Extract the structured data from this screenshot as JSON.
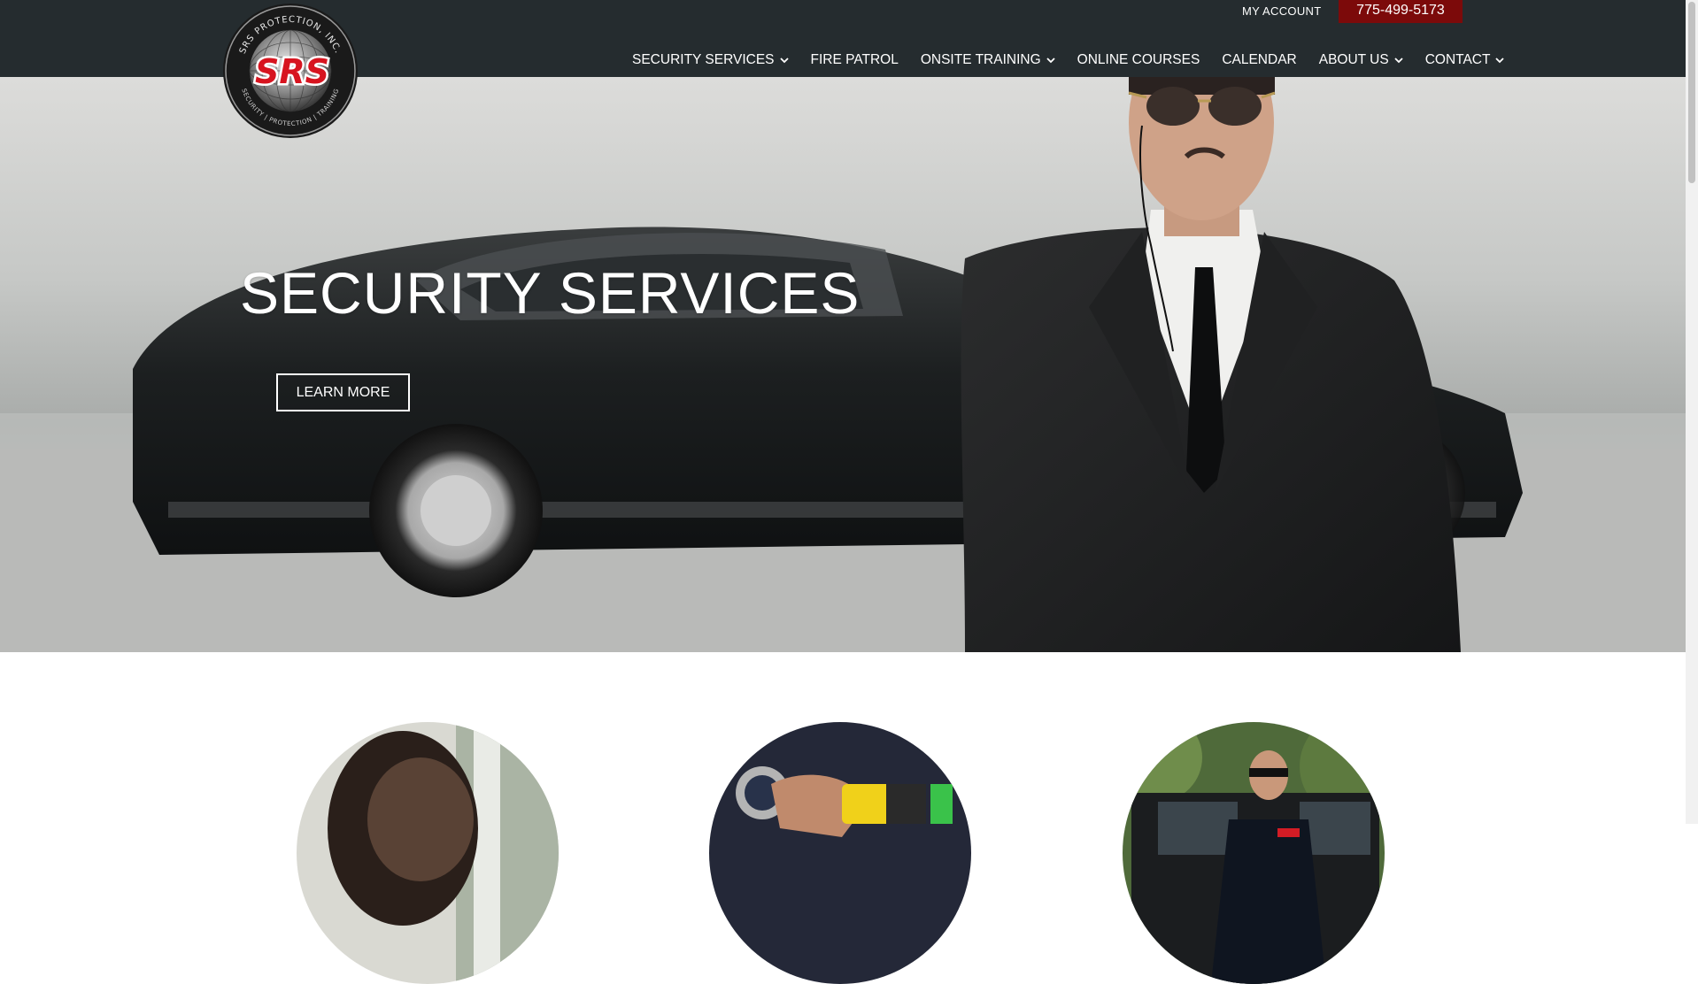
{
  "header": {
    "logo_alt": "SRS Protection, Inc. logo",
    "logo_text": {
      "arc_top": "SRS PROTECTION, INC.",
      "mark": "SRS",
      "arc_bottom": "SECURITY | PROTECTION | TRAINING"
    },
    "my_account": "MY ACCOUNT",
    "phone": "775-499-5173",
    "nav": [
      {
        "label": "SECURITY SERVICES",
        "has_dropdown": true
      },
      {
        "label": "FIRE PATROL",
        "has_dropdown": false
      },
      {
        "label": "ONSITE TRAINING",
        "has_dropdown": true
      },
      {
        "label": "ONLINE COURSES",
        "has_dropdown": false
      },
      {
        "label": "CALENDAR",
        "has_dropdown": false
      },
      {
        "label": "ABOUT US",
        "has_dropdown": true
      },
      {
        "label": "CONTACT",
        "has_dropdown": true
      }
    ]
  },
  "hero": {
    "title": "SECURITY SERVICES",
    "button": "LEARN MORE"
  },
  "colors": {
    "header_bg": "#252c2f",
    "phone_bg": "#7c0a0a",
    "logo_red": "#d7141f"
  }
}
